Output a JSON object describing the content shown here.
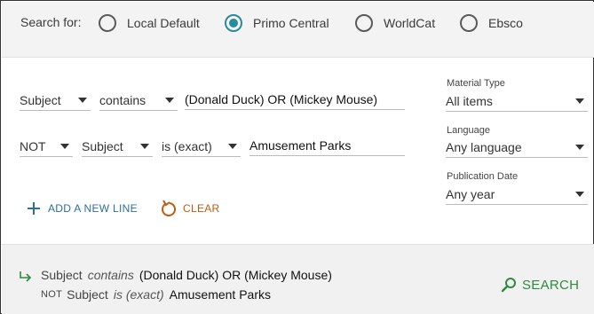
{
  "scope": {
    "label": "Search for:",
    "options": [
      {
        "label": "Local Default",
        "selected": false
      },
      {
        "label": "Primo Central",
        "selected": true
      },
      {
        "label": "WorldCat",
        "selected": false
      },
      {
        "label": "Ebsco",
        "selected": false
      }
    ]
  },
  "rows": [
    {
      "operator": "",
      "field": "Subject",
      "precision": "contains",
      "value": "(Donald Duck) OR (Mickey Mouse)"
    },
    {
      "operator": "NOT",
      "field": "Subject",
      "precision": "is (exact)",
      "value": "Amusement Parks"
    }
  ],
  "filters": {
    "material": {
      "label": "Material Type",
      "value": "All items"
    },
    "language": {
      "label": "Language",
      "value": "Any language"
    },
    "date": {
      "label": "Publication Date",
      "value": "Any year"
    }
  },
  "actions": {
    "add_line": "ADD A NEW LINE",
    "clear": "CLEAR"
  },
  "summary": {
    "line1": {
      "field": "Subject",
      "precision": "contains",
      "value": "(Donald Duck) OR (Mickey Mouse)"
    },
    "line2": {
      "operator": "NOT",
      "field": "Subject",
      "precision": "is (exact)",
      "value": "Amusement Parks"
    },
    "search_label": "SEARCH"
  },
  "colors": {
    "accent_teal": "#2a8a9a",
    "link_blue": "#2e6e9e",
    "clear_orange": "#c05a10",
    "search_green": "#2e8a3e"
  },
  "icons": [
    "radio-icon",
    "plus-icon",
    "refresh-icon",
    "return-arrow-icon",
    "magnifier-icon",
    "caret-down-icon"
  ]
}
